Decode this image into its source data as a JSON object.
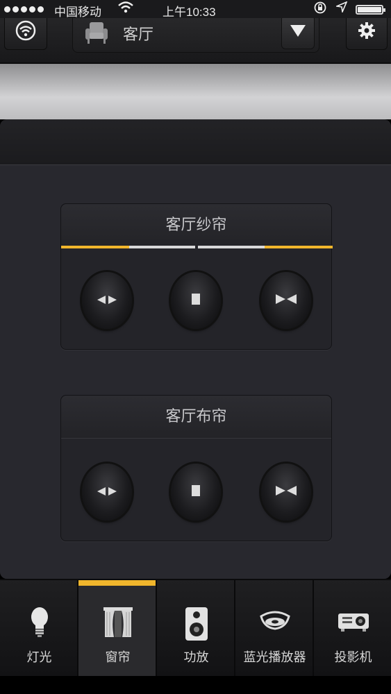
{
  "status_bar": {
    "carrier": "中国移动",
    "time": "上午10:33"
  },
  "header": {
    "room_name": "客厅",
    "icons": [
      "wifi-icon",
      "armchair-icon",
      "dropdown-triangle-icon",
      "gear-icon"
    ]
  },
  "cards": [
    {
      "title": "客厅纱帘",
      "progress_highlight": true,
      "buttons": [
        "open-curtain",
        "stop",
        "close-curtain"
      ]
    },
    {
      "title": "客厅布帘",
      "progress_highlight": false,
      "buttons": [
        "open-curtain",
        "stop",
        "close-curtain"
      ]
    }
  ],
  "tabs": [
    {
      "label": "灯光",
      "icon": "lightbulb-icon",
      "active": false
    },
    {
      "label": "窗帘",
      "icon": "curtain-icon",
      "active": true
    },
    {
      "label": "功放",
      "icon": "speaker-icon",
      "active": false
    },
    {
      "label": "蓝光播放器",
      "icon": "bluray-icon",
      "active": false
    },
    {
      "label": "投影机",
      "icon": "projector-icon",
      "active": false
    }
  ],
  "colors": {
    "accent": "#f1b62c",
    "panel": "#28282e"
  }
}
